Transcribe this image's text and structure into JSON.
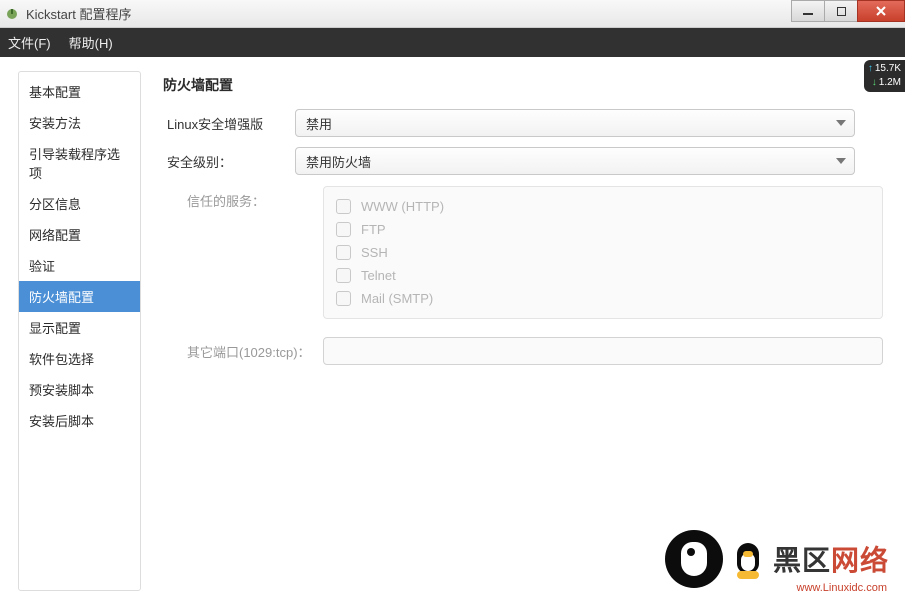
{
  "window": {
    "title": "Kickstart 配置程序"
  },
  "menubar": {
    "file": "文件(F)",
    "help": "帮助(H)"
  },
  "sidebar": {
    "items": [
      {
        "label": "基本配置"
      },
      {
        "label": "安装方法"
      },
      {
        "label": "引导装载程序选项"
      },
      {
        "label": "分区信息"
      },
      {
        "label": "网络配置"
      },
      {
        "label": "验证"
      },
      {
        "label": "防火墙配置"
      },
      {
        "label": "显示配置"
      },
      {
        "label": "软件包选择"
      },
      {
        "label": "预安装脚本"
      },
      {
        "label": "安装后脚本"
      }
    ],
    "selected_index": 6
  },
  "main": {
    "title": "防火墙配置",
    "selinux_label": "Linux安全增强版",
    "selinux_value": "禁用",
    "level_label": "安全级别：",
    "level_value": "禁用防火墙",
    "trusted_label": "信任的服务：",
    "services": [
      {
        "label": "WWW (HTTP)"
      },
      {
        "label": "FTP"
      },
      {
        "label": "SSH"
      },
      {
        "label": "Telnet"
      },
      {
        "label": "Mail (SMTP)"
      }
    ],
    "other_ports_label": "其它端口(1029:tcp)："
  },
  "net_badge": {
    "up": "15.7K",
    "down": "1.2M"
  },
  "watermark": {
    "text_black": "黑区",
    "text_red": "网络",
    "url": "www.Linuxidc.com"
  }
}
